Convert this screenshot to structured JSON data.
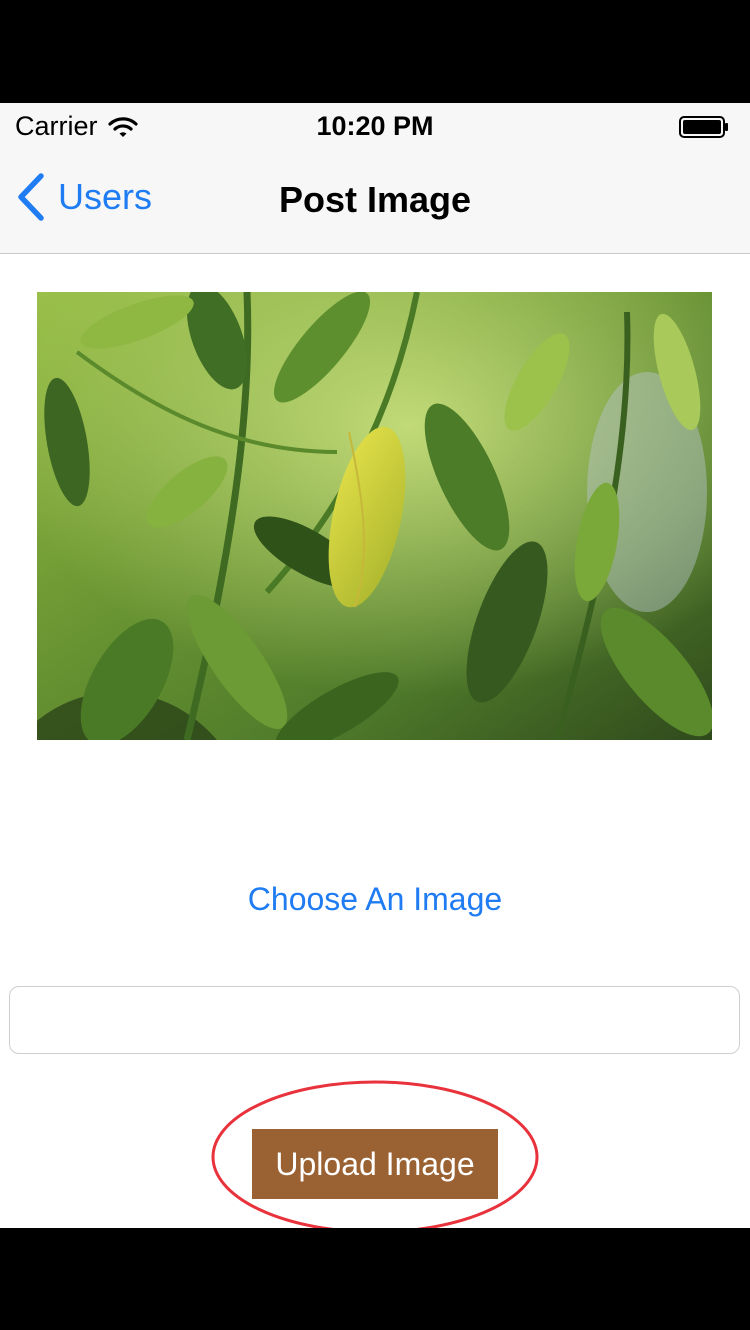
{
  "status_bar": {
    "carrier": "Carrier",
    "time": "10:20 PM",
    "wifi_icon": "wifi-icon",
    "battery_icon": "battery-icon"
  },
  "nav": {
    "back_label": "Users",
    "back_icon": "chevron-left-icon",
    "title": "Post Image"
  },
  "content": {
    "photo_subject": "photo-of-green-citrus-leaves",
    "choose_label": "Choose An Image",
    "caption_value": "",
    "caption_placeholder": "",
    "upload_label": "Upload Image"
  },
  "colors": {
    "accent": "#1f7cf2",
    "upload_button": "#9a6233",
    "highlight_ring": "#e8323c"
  }
}
